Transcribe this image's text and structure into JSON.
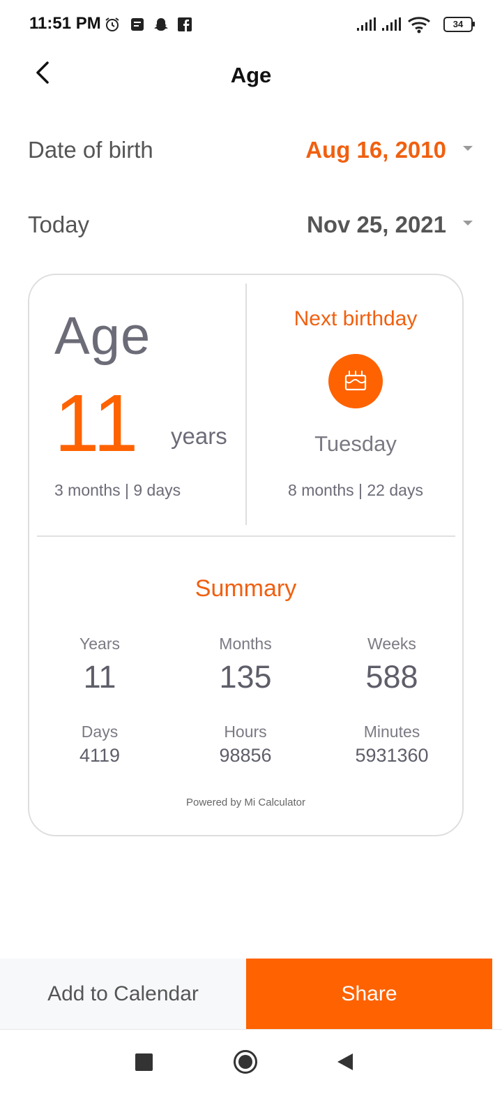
{
  "status_bar": {
    "time": "11:51 PM",
    "battery": "34",
    "icons": [
      "alarm-icon",
      "message-icon",
      "snapchat-icon",
      "facebook-icon",
      "signal-icon",
      "signal-icon",
      "wifi-icon",
      "battery-icon"
    ]
  },
  "header": {
    "title": "Age",
    "back_icon": "back-chevron-icon"
  },
  "date_of_birth": {
    "label": "Date of birth",
    "value": "Aug 16, 2010"
  },
  "today": {
    "label": "Today",
    "value": "Nov 25, 2021"
  },
  "age": {
    "label": "Age",
    "years_value": "11",
    "years_unit": "years",
    "detail": "3 months | 9 days"
  },
  "next_birthday": {
    "title": "Next birthday",
    "icon": "birthday-cake-icon",
    "day": "Tuesday",
    "detail": "8 months | 22 days"
  },
  "summary": {
    "title": "Summary",
    "stats": [
      {
        "label": "Years",
        "value": "11"
      },
      {
        "label": "Months",
        "value": "135"
      },
      {
        "label": "Weeks",
        "value": "588"
      },
      {
        "label": "Days",
        "value": "4119"
      },
      {
        "label": "Hours",
        "value": "98856"
      },
      {
        "label": "Minutes",
        "value": "5931360"
      }
    ],
    "powered_by": "Powered by Mi Calculator"
  },
  "actions": {
    "add_to_calendar": "Add to Calendar",
    "share": "Share"
  },
  "colors": {
    "accent": "#ff6200",
    "text_gray": "#6c6c78"
  },
  "nav_bar": {
    "icons": [
      "recents-square-icon",
      "home-circle-icon",
      "back-triangle-icon"
    ]
  }
}
